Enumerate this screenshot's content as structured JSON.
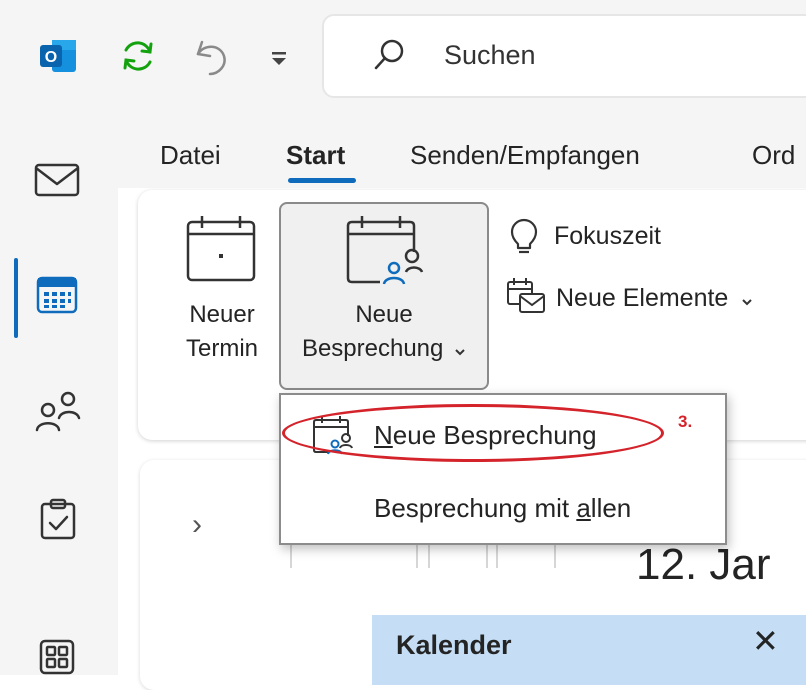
{
  "titlebar": {
    "search_placeholder": "Suchen",
    "app_icon_letter": "O"
  },
  "nav_rail": {
    "items": [
      {
        "name": "mail",
        "icon": "mail-icon"
      },
      {
        "name": "calendar",
        "icon": "calendar-icon",
        "active": true
      },
      {
        "name": "people",
        "icon": "people-icon"
      },
      {
        "name": "tasks",
        "icon": "tasks-icon"
      },
      {
        "name": "apps",
        "icon": "apps-icon"
      }
    ]
  },
  "tabs": [
    {
      "label": "Datei"
    },
    {
      "label": "Start",
      "active": true
    },
    {
      "label": "Senden/Empfangen"
    },
    {
      "label": "Ord"
    }
  ],
  "ribbon": {
    "new_appointment": {
      "line1": "Neuer",
      "line2": "Termin"
    },
    "new_meeting": {
      "line1": "Neue",
      "line2": "Besprechung"
    },
    "focus_time": "Fokuszeit",
    "new_items": "Neue Elemente"
  },
  "dropdown": {
    "items": [
      {
        "prefix": "",
        "mnemonic": "N",
        "suffix": "eue Besprechung"
      },
      {
        "prefix": "Besprechung mit ",
        "mnemonic": "a",
        "suffix": "llen"
      }
    ],
    "annotation": "3."
  },
  "calendar": {
    "date_header": "12. Jar",
    "panel_title": "Kalender",
    "close_symbol": "✕",
    "collapse_symbol": "›"
  },
  "colors": {
    "accent": "#0f6cbd",
    "annotation_red": "#d4232a",
    "panel_blue": "#c5def5"
  }
}
